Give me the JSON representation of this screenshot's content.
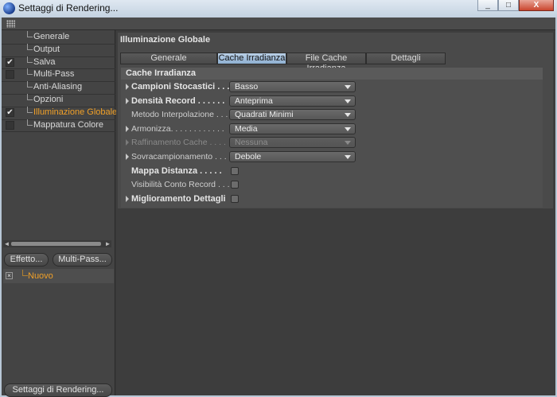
{
  "window": {
    "title": "Settaggi di Rendering...",
    "min_glyph": "_",
    "max_glyph": "□",
    "close_glyph": "X"
  },
  "sidebar": {
    "items": [
      {
        "label": "Generale",
        "checked": null,
        "active": false
      },
      {
        "label": "Output",
        "checked": null,
        "active": false
      },
      {
        "label": "Salva",
        "checked": true,
        "active": false
      },
      {
        "label": "Multi-Pass",
        "checked": false,
        "active": false
      },
      {
        "label": "Anti-Aliasing",
        "checked": null,
        "active": false
      },
      {
        "label": "Opzioni",
        "checked": null,
        "active": false
      },
      {
        "label": "Illuminazione Globale",
        "checked": true,
        "active": true
      },
      {
        "label": "Mappatura Colore",
        "checked": false,
        "active": false
      }
    ],
    "check_glyph": "✔",
    "scroll_left": "◄",
    "scroll_right": "►",
    "effect_button": "Effetto...",
    "multipass_button": "Multi-Pass...",
    "pass_item": "Nuovo",
    "pass_check_glyph": "×",
    "render_settings_button": "Settaggi di Rendering..."
  },
  "main": {
    "section_title": "Illuminazione Globale",
    "tabs": [
      "Generale",
      "Cache Irradianza",
      "File Cache Irradianza",
      "Dettagli"
    ],
    "active_tab": 1,
    "group_title": "Cache Irradianza",
    "params": [
      {
        "label": "Campioni Stocastici . . .",
        "type": "select",
        "value": "Basso",
        "bold": true,
        "arrow": true,
        "disabled": false
      },
      {
        "label": "Densità Record . . . . . .",
        "type": "select",
        "value": "Anteprima",
        "bold": true,
        "arrow": true,
        "disabled": false
      },
      {
        "label": "Metodo Interpolazione . . .",
        "type": "select",
        "value": "Quadrati Minimi",
        "bold": false,
        "arrow": false,
        "disabled": false
      },
      {
        "label": "Armonizza. . . . . . . . . . . .",
        "type": "select",
        "value": "Media",
        "bold": false,
        "arrow": true,
        "disabled": false
      },
      {
        "label": "Raffinamento Cache . . . .",
        "type": "select",
        "value": "Nessuna",
        "bold": false,
        "arrow": true,
        "disabled": true
      },
      {
        "label": "Sovracampionamento . . . .",
        "type": "select",
        "value": "Debole",
        "bold": false,
        "arrow": true,
        "disabled": false
      },
      {
        "label": "Mappa Distanza . . . . .",
        "type": "checkbox",
        "value": false,
        "bold": true,
        "arrow": false,
        "disabled": false
      },
      {
        "label": "Visibilità Conto Record . . .",
        "type": "checkbox",
        "value": false,
        "bold": false,
        "arrow": false,
        "disabled": false
      },
      {
        "label": "Miglioramento Dettagli",
        "type": "checkbox",
        "value": false,
        "bold": true,
        "arrow": true,
        "disabled": false
      }
    ]
  }
}
